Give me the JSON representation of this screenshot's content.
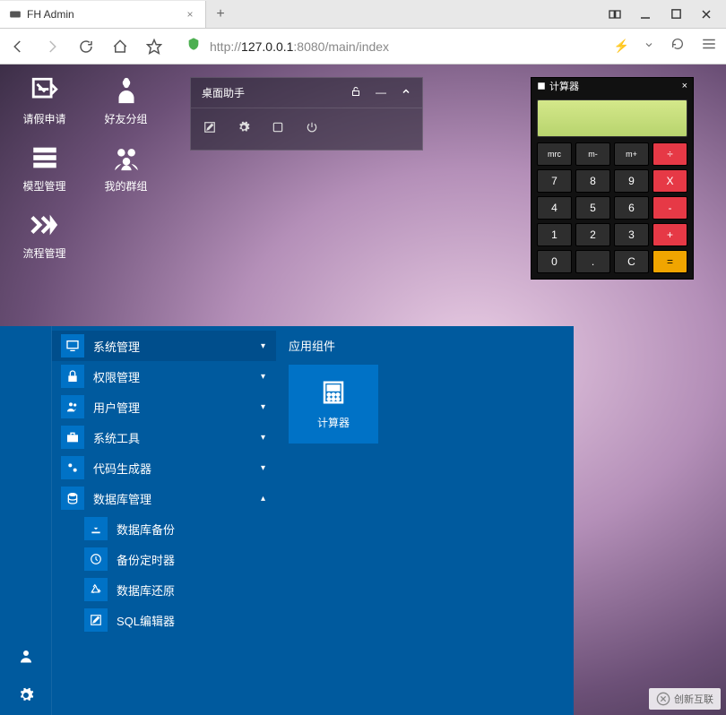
{
  "browser": {
    "tab_title": "FH Admin",
    "url_prefix": "http://",
    "url_host": "127.0.0.1",
    "url_port": ":8080",
    "url_path": "/main/index"
  },
  "desktop": {
    "icons": [
      {
        "id": "leave",
        "label": "请假申请"
      },
      {
        "id": "friends",
        "label": "好友分组"
      },
      {
        "id": "model",
        "label": "模型管理"
      },
      {
        "id": "groups",
        "label": "我的群组"
      },
      {
        "id": "flow",
        "label": "流程管理"
      }
    ]
  },
  "assistant": {
    "title": "桌面助手"
  },
  "calculator": {
    "title": "计算器",
    "buttons_row1": [
      "mrc",
      "m-",
      "m+",
      "÷"
    ],
    "buttons_row2": [
      "7",
      "8",
      "9",
      "X"
    ],
    "buttons_row3": [
      "4",
      "5",
      "6",
      "-"
    ],
    "buttons_row4": [
      "1",
      "2",
      "3",
      "+"
    ],
    "buttons_row5": [
      "0",
      ".",
      "C",
      "="
    ]
  },
  "startmenu": {
    "items": [
      {
        "label": "系统管理",
        "expanded": false
      },
      {
        "label": "权限管理",
        "expanded": false
      },
      {
        "label": "用户管理",
        "expanded": false
      },
      {
        "label": "系统工具",
        "expanded": false
      },
      {
        "label": "代码生成器",
        "expanded": false
      },
      {
        "label": "数据库管理",
        "expanded": true
      }
    ],
    "subitems": [
      {
        "label": "数据库备份"
      },
      {
        "label": "备份定时器"
      },
      {
        "label": "数据库还原"
      },
      {
        "label": "SQL编辑器"
      }
    ],
    "right_title": "应用组件",
    "app_tile": "计算器"
  },
  "watermark": "创新互联"
}
